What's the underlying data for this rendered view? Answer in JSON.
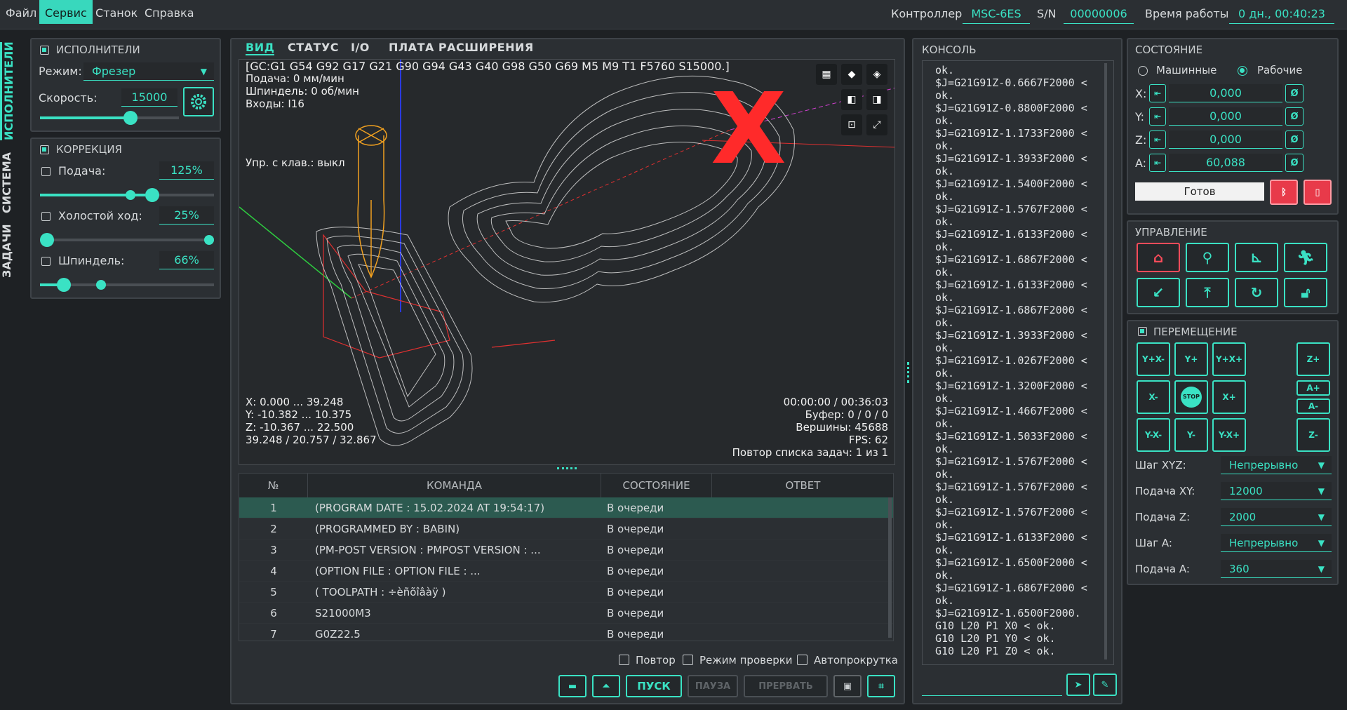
{
  "menu": {
    "file": "Файл",
    "service": "Сервис",
    "machine": "Станок",
    "help": "Справка"
  },
  "titlebar": {
    "controller_label": "Контроллер",
    "controller_value": "MSC-6ES",
    "sn_label": "S/N",
    "sn_value": "00000006",
    "uptime_label": "Время работы",
    "uptime_value": "0 дн., 00:40:23"
  },
  "side_tabs": {
    "executors": "ИСПОЛНИТЕЛИ",
    "system": "СИСТЕМА",
    "tasks": "ЗАДАЧИ"
  },
  "executors": {
    "title": "ИСПОЛНИТЕЛИ",
    "mode_label": "Режим:",
    "mode_value": "Фрезер",
    "speed_label": "Скорость:",
    "speed_value": "15000",
    "speed_level": 0.65
  },
  "correction": {
    "title": "КОРРЕКЦИЯ",
    "feed_label": "Подача:",
    "feed_value": "125%",
    "idle_label": "Холостой ход:",
    "idle_value": "25%",
    "spindle_label": "Шпиндель:",
    "spindle_value": "66%"
  },
  "view_tabs": [
    "ВИД",
    "СТАТУС",
    "I/O",
    "ПЛАТА РАСШИРЕНИЯ"
  ],
  "viewport": {
    "gc_line": "[GC:G1 G54 G92 G17 G21 G90 G94 G43 G40 G98 G50 G69 M5 M9 T1 F5760 S15000.]",
    "feed": "Подача: 0 мм/мин",
    "spindle": "Шпиндель: 0 об/мин",
    "inputs": "Входы: I16",
    "keyboard": "Упр. с клав.: выкл",
    "x_range": "X: 0.000 ... 39.248",
    "y_range": "Y: -10.382 ... 10.375",
    "z_range": "Z: -10.367 ... 22.500",
    "size": "39.248 / 20.757 / 32.867",
    "time": "00:00:00 / 00:36:03",
    "buffer": "Буфер: 0 / 0 / 0",
    "vertices": "Вершины: 45688",
    "fps": "FPS: 62",
    "repeat": "Повтор списка задач: 1 из 1",
    "x_mark": "X"
  },
  "table": {
    "headers": [
      "№",
      "КОМАНДА",
      "СОСТОЯНИЕ",
      "ОТВЕТ"
    ],
    "rows": [
      {
        "n": "1",
        "cmd": "(PROGRAM DATE     : 15.02.2024 AT 19:54:17)",
        "state": "В очереди",
        "resp": ""
      },
      {
        "n": "2",
        "cmd": "(PROGRAMMED BY    : BABIN)",
        "state": "В очереди",
        "resp": ""
      },
      {
        "n": "3",
        "cmd": "(PM-POST VERSION  : PMPOST VERSION : ...",
        "state": "В очереди",
        "resp": ""
      },
      {
        "n": "4",
        "cmd": "(OPTION FILE      : OPTION FILE : ...",
        "state": "В очереди",
        "resp": ""
      },
      {
        "n": "5",
        "cmd": "( TOOLPATH : ÷èñõîâàÿ )",
        "state": "В очереди",
        "resp": ""
      },
      {
        "n": "6",
        "cmd": "S21000M3",
        "state": "В очереди",
        "resp": ""
      },
      {
        "n": "7",
        "cmd": "G0Z22.5",
        "state": "В очереди",
        "resp": ""
      }
    ]
  },
  "options": {
    "repeat": "Повтор",
    "check_mode": "Режим проверки",
    "autoscroll": "Автопрокрутка"
  },
  "actions": {
    "start": "ПУСК",
    "pause": "ПАУЗА",
    "abort": "ПРЕРВАТЬ"
  },
  "console": {
    "title": "КОНСОЛЬ",
    "lines": [
      "ok.",
      "$J=G21G91Z-0.6667F2000 <",
      "ok.",
      "$J=G21G91Z-0.8800F2000 <",
      "ok.",
      "$J=G21G91Z-1.1733F2000 <",
      "ok.",
      "$J=G21G91Z-1.3933F2000 <",
      "ok.",
      "$J=G21G91Z-1.5400F2000 <",
      "ok.",
      "$J=G21G91Z-1.5767F2000 <",
      "ok.",
      "$J=G21G91Z-1.6133F2000 <",
      "ok.",
      "$J=G21G91Z-1.6867F2000 <",
      "ok.",
      "$J=G21G91Z-1.6133F2000 <",
      "ok.",
      "$J=G21G91Z-1.6867F2000 <",
      "ok.",
      "$J=G21G91Z-1.3933F2000 <",
      "ok.",
      "$J=G21G91Z-1.0267F2000 <",
      "ok.",
      "$J=G21G91Z-1.3200F2000 <",
      "ok.",
      "$J=G21G91Z-1.4667F2000 <",
      "ok.",
      "$J=G21G91Z-1.5033F2000 <",
      "ok.",
      "$J=G21G91Z-1.5767F2000 <",
      "ok.",
      "$J=G21G91Z-1.5767F2000 <",
      "ok.",
      "$J=G21G91Z-1.5767F2000 <",
      "ok.",
      "$J=G21G91Z-1.6133F2000 <",
      "ok.",
      "$J=G21G91Z-1.6500F2000 <",
      "ok.",
      "$J=G21G91Z-1.6867F2000 <",
      "ok.",
      "$J=G21G91Z-1.6500F2000.",
      "G10 L20 P1 X0 < ok.",
      "G10 L20 P1 Y0 < ok.",
      "G10 L20 P1 Z0 < ok."
    ],
    "input_placeholder": ""
  },
  "state": {
    "title": "СОСТОЯНИЕ",
    "machine": "Машинные",
    "work": "Рабочие",
    "axes": [
      {
        "name": "X:",
        "value": "0,000"
      },
      {
        "name": "Y:",
        "value": "0,000"
      },
      {
        "name": "Z:",
        "value": "0,000"
      },
      {
        "name": "A:",
        "value": "60,088"
      }
    ],
    "zero": "Ø",
    "status": "Готов"
  },
  "control": {
    "title": "УПРАВЛЕНИЕ"
  },
  "movement": {
    "title": "ПЕРЕМЕЩЕНИЕ",
    "jog": {
      "ymxm": "Y+X-",
      "yp": "Y+",
      "ypxp": "Y+X+",
      "xm": "X-",
      "stop": "STOP",
      "xp": "X+",
      "ymxm2": "Y-X-",
      "ym": "Y-",
      "ymxp": "Y-X+",
      "zp": "Z+",
      "ap": "A+",
      "am": "A-",
      "zm": "Z-"
    },
    "step_xyz_label": "Шаг XYZ:",
    "step_xyz": "Непрерывно",
    "feed_xy_label": "Подача XY:",
    "feed_xy": "12000",
    "feed_z_label": "Подача Z:",
    "feed_z": "2000",
    "step_a_label": "Шаг A:",
    "step_a": "Непрерывно",
    "feed_a_label": "Подача A:",
    "feed_a": "360"
  },
  "colors": {
    "accent": "#3ae2c4",
    "alert": "#ff2a2a",
    "panel": "#2b2f33"
  }
}
